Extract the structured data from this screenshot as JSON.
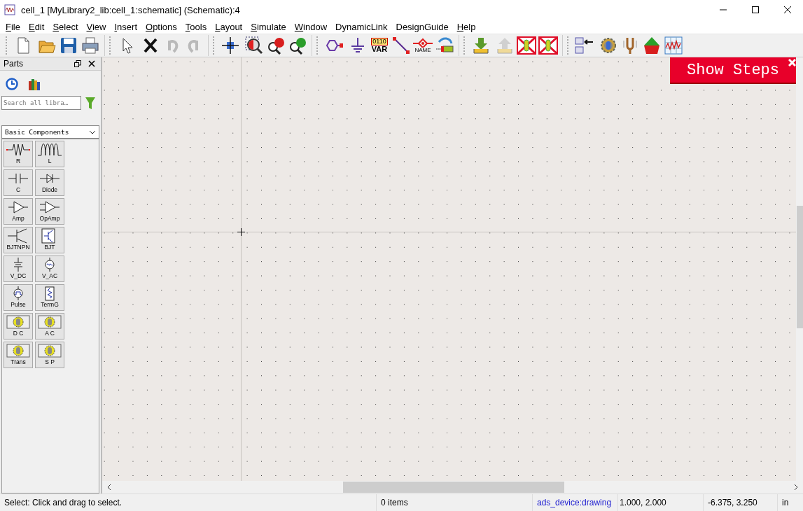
{
  "window": {
    "title": "cell_1 [MyLibrary2_lib:cell_1:schematic] (Schematic):4"
  },
  "menu": [
    {
      "label": "File",
      "underlined": true
    },
    {
      "label": "Edit",
      "underlined": true
    },
    {
      "label": "Select",
      "underlined": true
    },
    {
      "label": "View",
      "underlined": true
    },
    {
      "label": "Insert",
      "underlined": true
    },
    {
      "label": "Options",
      "underlined": true
    },
    {
      "label": "Tools",
      "underlined": true
    },
    {
      "label": "Layout",
      "underlined": true
    },
    {
      "label": "Simulate",
      "underlined": true
    },
    {
      "label": "Window",
      "underlined": true
    },
    {
      "label": "DynamicLink",
      "underlined": false
    },
    {
      "label": "DesignGuide",
      "underlined": false
    },
    {
      "label": "Help",
      "underlined": true
    }
  ],
  "toolbar": [
    [
      {
        "kind": "new",
        "disabled": false
      },
      {
        "kind": "open",
        "disabled": false
      },
      {
        "kind": "save",
        "disabled": false
      },
      {
        "kind": "print",
        "disabled": false
      }
    ],
    [
      {
        "kind": "pointer",
        "disabled": false
      },
      {
        "kind": "delete",
        "disabled": false
      },
      {
        "kind": "undo",
        "disabled": true
      },
      {
        "kind": "redo",
        "disabled": true
      }
    ],
    [
      {
        "kind": "pan",
        "disabled": false
      },
      {
        "kind": "zoom-area",
        "disabled": false
      },
      {
        "kind": "zoom-in",
        "disabled": false
      },
      {
        "kind": "zoom-out",
        "disabled": false
      }
    ],
    [
      {
        "kind": "port",
        "disabled": false
      },
      {
        "kind": "ground",
        "disabled": false
      },
      {
        "kind": "var",
        "disabled": false,
        "code": "0110",
        "label": "VAR"
      },
      {
        "kind": "wire",
        "disabled": false
      },
      {
        "kind": "name",
        "disabled": false,
        "label": "NAME"
      },
      {
        "kind": "push",
        "disabled": false
      }
    ],
    [
      {
        "kind": "push-down",
        "disabled": false
      },
      {
        "kind": "pop-up",
        "disabled": true
      },
      {
        "kind": "deactivate",
        "disabled": false
      },
      {
        "kind": "deactivate",
        "disabled": false
      }
    ],
    [
      {
        "kind": "netlist",
        "disabled": false
      },
      {
        "kind": "gear",
        "disabled": false
      },
      {
        "kind": "tuning",
        "disabled": false
      },
      {
        "kind": "arrow-up",
        "disabled": false
      },
      {
        "kind": "graph",
        "disabled": false
      }
    ]
  ],
  "parts": {
    "title": "Parts",
    "search": {
      "placeholder": "Search all libra…"
    },
    "library": "Basic Components",
    "items": [
      {
        "label": "R",
        "kind": "resistor"
      },
      {
        "label": "L",
        "kind": "inductor"
      },
      {
        "label": "C",
        "kind": "capacitor"
      },
      {
        "label": "Diode",
        "kind": "diode"
      },
      {
        "label": "Amp",
        "kind": "amp"
      },
      {
        "label": "OpAmp",
        "kind": "opamp"
      },
      {
        "label": "BJTNPN",
        "kind": "bjt"
      },
      {
        "label": "BJT",
        "kind": "bjt-box"
      },
      {
        "label": "V_DC",
        "kind": "vdc"
      },
      {
        "label": "V_AC",
        "kind": "vac"
      },
      {
        "label": "Pulse",
        "kind": "pulse"
      },
      {
        "label": "TermG",
        "kind": "term"
      },
      {
        "label": "D C",
        "kind": "sim"
      },
      {
        "label": "A C",
        "kind": "sim"
      },
      {
        "label": "Trans",
        "kind": "sim"
      },
      {
        "label": "S P",
        "kind": "sim"
      }
    ]
  },
  "banner": {
    "label": "Show Steps"
  },
  "status_bar": {
    "message": "Select: Click and drag to select.",
    "items": "0 items",
    "layer": "ads_device:drawing",
    "position": "1.000, 2.000",
    "cursor": "-6.375, 3.250",
    "units": "in"
  }
}
